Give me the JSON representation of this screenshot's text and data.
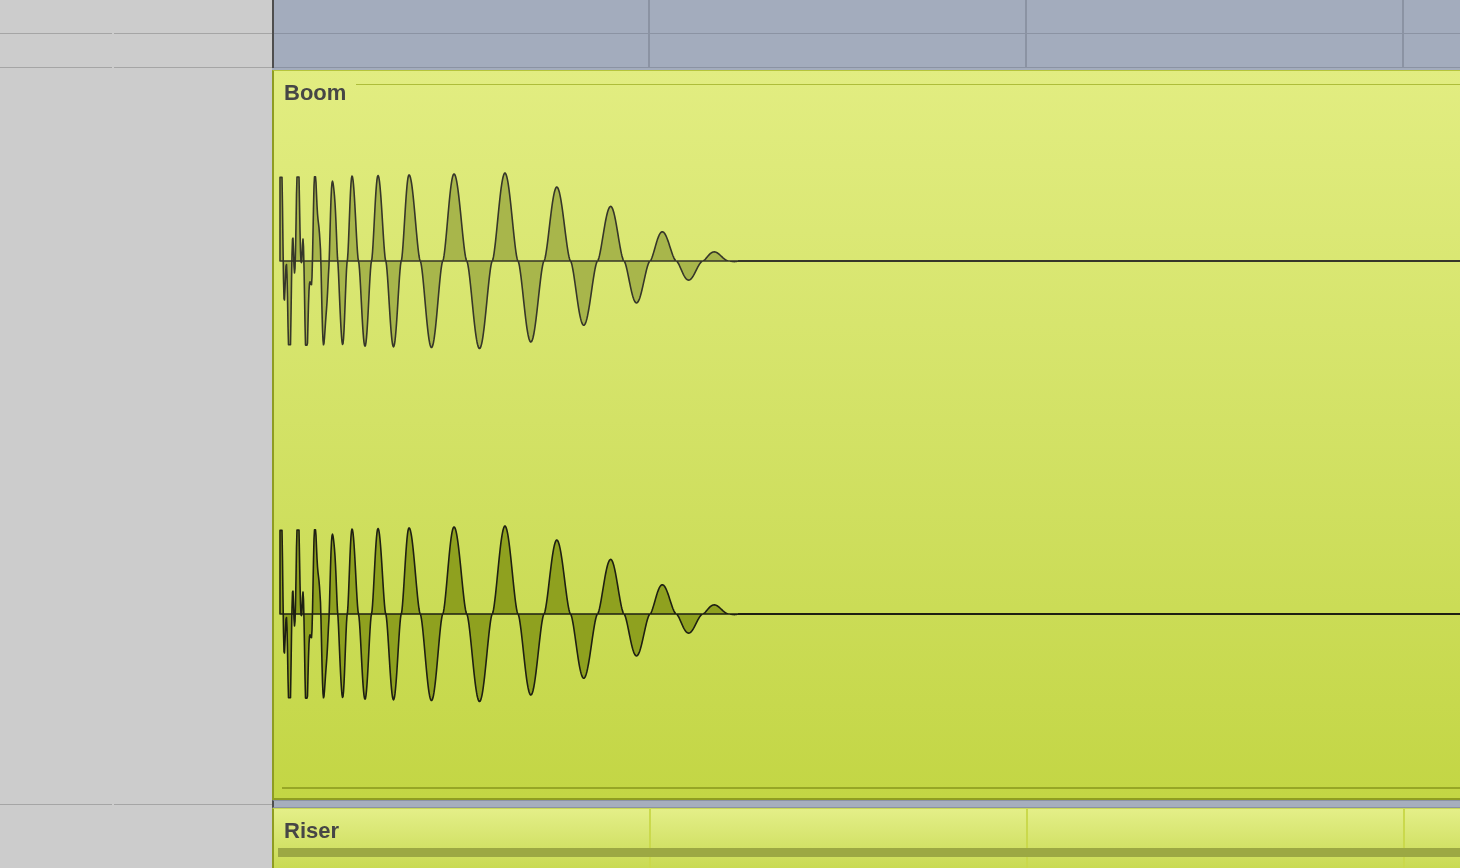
{
  "arrangement": {
    "clips": [
      {
        "title": "Boom",
        "kind": "waveform"
      },
      {
        "title": "Riser",
        "kind": "strip"
      }
    ]
  }
}
